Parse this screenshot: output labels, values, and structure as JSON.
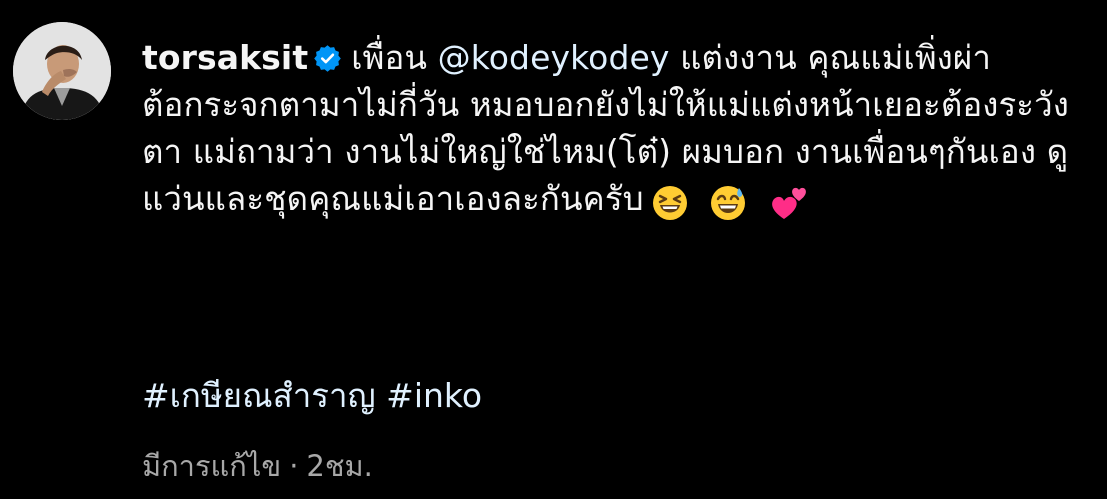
{
  "post": {
    "username": "torsaksit",
    "verified": true,
    "caption_before_mention": "เพื่อน ",
    "mention": "@kodeykodey",
    "caption_after_mention": " แต่งงาน คุณแม่เพิ่งผ่าต้อกระจกตามาไม่กี่วัน หมอบอกยังไม่ให้แม่แต่งหน้าเยอะต้องระวังตา แม่ถามว่า งานไม่ใหญ่ใช่ไหม(โต๋) ผมบอก งานเพื่อนๆกันเอง ดูแว่นและชุดคุณแม่เอาเองละกันครับ",
    "emojis": [
      "grinning-squinting-face",
      "grinning-face-with-sweat",
      "two-hearts"
    ],
    "hashtags": [
      "#เกษียณสำราญ",
      "#inko"
    ],
    "edited_label": "มีการแก้ไข",
    "separator": "·",
    "time_ago": "2ชม."
  },
  "icons": {
    "verified": "verified-badge-icon",
    "avatar": "profile-avatar"
  },
  "colors": {
    "background": "#000000",
    "text": "#f5f5f5",
    "link": "#e0f1ff",
    "meta": "#a8a8a8",
    "verified": "#0095f6"
  }
}
